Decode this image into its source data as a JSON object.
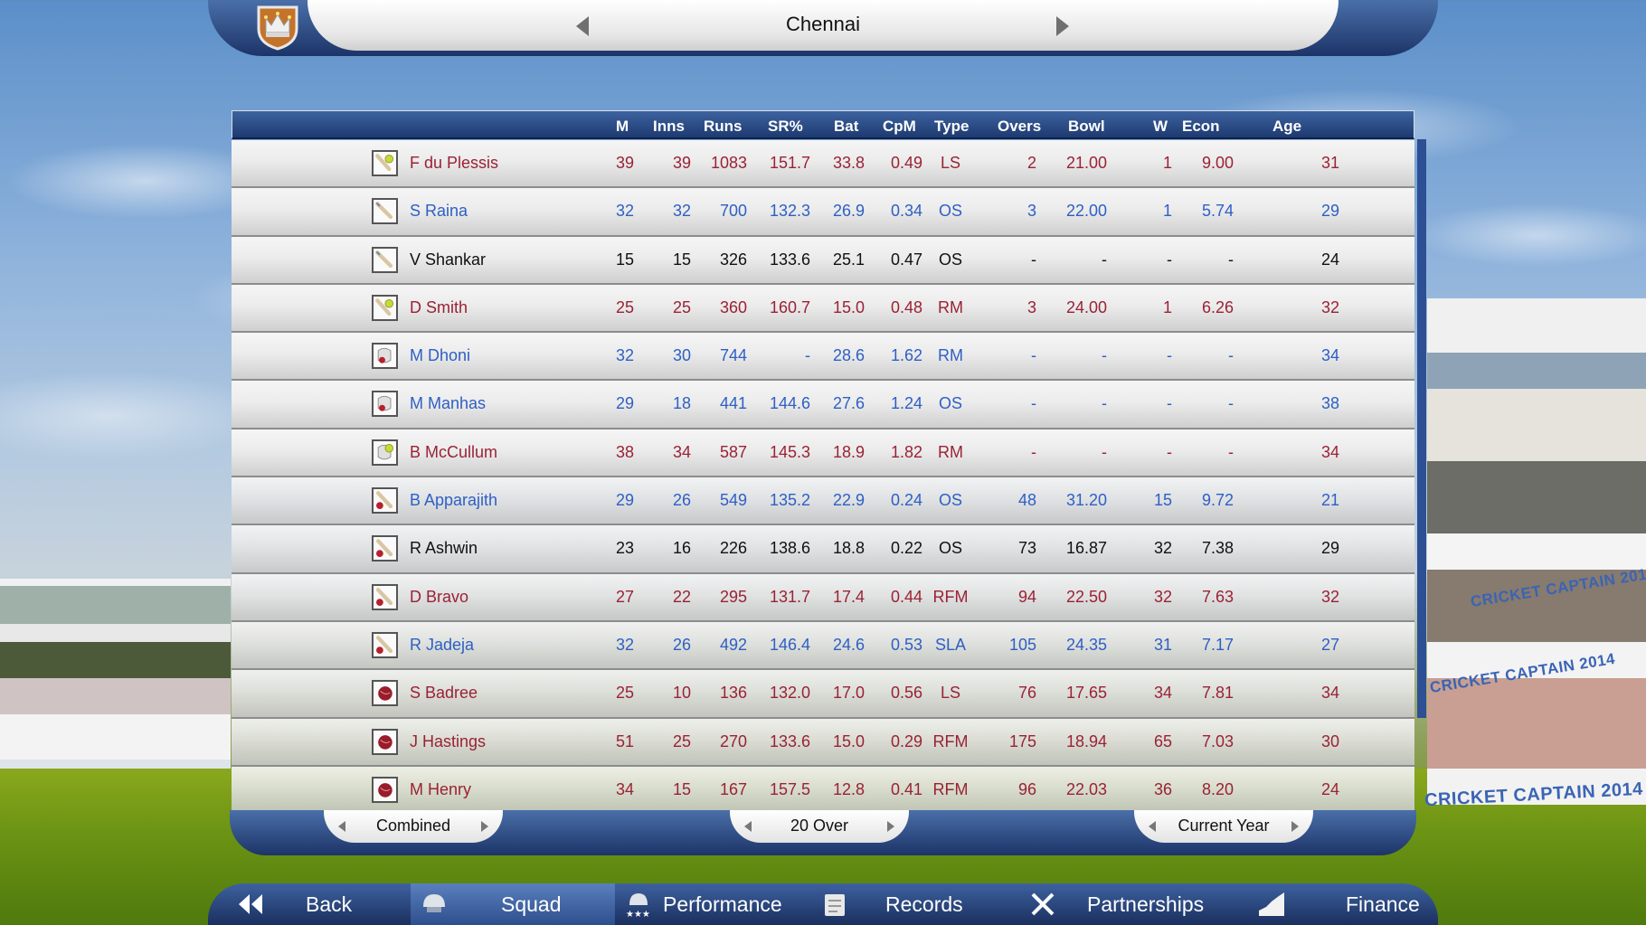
{
  "header": {
    "team": "Chennai",
    "crest_icon": "crown-shield-icon",
    "prev_icon": "arrow-left-icon",
    "next_icon": "arrow-right-icon"
  },
  "table": {
    "columns": [
      "M",
      "Inns",
      "Runs",
      "SR%",
      "Bat",
      "CpM",
      "Type",
      "Overs",
      "Bowl",
      "W",
      "Econ",
      "Age"
    ],
    "colors": {
      "red": "#9a2235",
      "blue": "#2e5fc4",
      "black": "#111111"
    },
    "rows": [
      {
        "role": "batsman-keeper-icon",
        "color": "red",
        "name": "F du Plessis",
        "M": "39",
        "Inns": "39",
        "Runs": "1083",
        "SR": "151.7",
        "Bat": "33.8",
        "CpM": "0.49",
        "Type": "LS",
        "Overs": "2",
        "Bowl": "21.00",
        "W": "1",
        "Econ": "9.00",
        "Age": "31"
      },
      {
        "role": "batsman-icon",
        "color": "blue",
        "name": "S Raina",
        "M": "32",
        "Inns": "32",
        "Runs": "700",
        "SR": "132.3",
        "Bat": "26.9",
        "CpM": "0.34",
        "Type": "OS",
        "Overs": "3",
        "Bowl": "22.00",
        "W": "1",
        "Econ": "5.74",
        "Age": "29"
      },
      {
        "role": "batsman-icon",
        "color": "black",
        "name": "V Shankar",
        "M": "15",
        "Inns": "15",
        "Runs": "326",
        "SR": "133.6",
        "Bat": "25.1",
        "CpM": "0.47",
        "Type": "OS",
        "Overs": "-",
        "Bowl": "-",
        "W": "-",
        "Econ": "-",
        "Age": "24"
      },
      {
        "role": "batsman-keeper-icon",
        "color": "red",
        "name": "D Smith",
        "M": "25",
        "Inns": "25",
        "Runs": "360",
        "SR": "160.7",
        "Bat": "15.0",
        "CpM": "0.48",
        "Type": "RM",
        "Overs": "3",
        "Bowl": "24.00",
        "W": "1",
        "Econ": "6.26",
        "Age": "32"
      },
      {
        "role": "wicketkeeper-icon",
        "color": "blue",
        "name": "M Dhoni",
        "M": "32",
        "Inns": "30",
        "Runs": "744",
        "SR": "-",
        "Bat": "28.6",
        "CpM": "1.62",
        "Type": "RM",
        "Overs": "-",
        "Bowl": "-",
        "W": "-",
        "Econ": "-",
        "Age": "34"
      },
      {
        "role": "wicketkeeper-icon",
        "color": "blue",
        "name": "M Manhas",
        "M": "29",
        "Inns": "18",
        "Runs": "441",
        "SR": "144.6",
        "Bat": "27.6",
        "CpM": "1.24",
        "Type": "OS",
        "Overs": "-",
        "Bowl": "-",
        "W": "-",
        "Econ": "-",
        "Age": "38"
      },
      {
        "role": "keeper-gloves-icon",
        "color": "red",
        "name": "B McCullum",
        "M": "38",
        "Inns": "34",
        "Runs": "587",
        "SR": "145.3",
        "Bat": "18.9",
        "CpM": "1.82",
        "Type": "RM",
        "Overs": "-",
        "Bowl": "-",
        "W": "-",
        "Econ": "-",
        "Age": "34"
      },
      {
        "role": "allrounder-icon",
        "color": "blue",
        "name": "B Apparajith",
        "M": "29",
        "Inns": "26",
        "Runs": "549",
        "SR": "135.2",
        "Bat": "22.9",
        "CpM": "0.24",
        "Type": "OS",
        "Overs": "48",
        "Bowl": "31.20",
        "W": "15",
        "Econ": "9.72",
        "Age": "21"
      },
      {
        "role": "allrounder-icon",
        "color": "black",
        "name": "R Ashwin",
        "M": "23",
        "Inns": "16",
        "Runs": "226",
        "SR": "138.6",
        "Bat": "18.8",
        "CpM": "0.22",
        "Type": "OS",
        "Overs": "73",
        "Bowl": "16.87",
        "W": "32",
        "Econ": "7.38",
        "Age": "29"
      },
      {
        "role": "allrounder-icon",
        "color": "red",
        "name": "D Bravo",
        "M": "27",
        "Inns": "22",
        "Runs": "295",
        "SR": "131.7",
        "Bat": "17.4",
        "CpM": "0.44",
        "Type": "RFM",
        "Overs": "94",
        "Bowl": "22.50",
        "W": "32",
        "Econ": "7.63",
        "Age": "32"
      },
      {
        "role": "allrounder-icon",
        "color": "blue",
        "name": "R Jadeja",
        "M": "32",
        "Inns": "26",
        "Runs": "492",
        "SR": "146.4",
        "Bat": "24.6",
        "CpM": "0.53",
        "Type": "SLA",
        "Overs": "105",
        "Bowl": "24.35",
        "W": "31",
        "Econ": "7.17",
        "Age": "27"
      },
      {
        "role": "bowler-icon",
        "color": "red",
        "name": "S Badree",
        "M": "25",
        "Inns": "10",
        "Runs": "136",
        "SR": "132.0",
        "Bat": "17.0",
        "CpM": "0.56",
        "Type": "LS",
        "Overs": "76",
        "Bowl": "17.65",
        "W": "34",
        "Econ": "7.81",
        "Age": "34"
      },
      {
        "role": "bowler-icon",
        "color": "red",
        "name": "J Hastings",
        "M": "51",
        "Inns": "25",
        "Runs": "270",
        "SR": "133.6",
        "Bat": "15.0",
        "CpM": "0.29",
        "Type": "RFM",
        "Overs": "175",
        "Bowl": "18.94",
        "W": "65",
        "Econ": "7.03",
        "Age": "30"
      },
      {
        "role": "bowler-icon",
        "color": "red",
        "name": "M Henry",
        "M": "34",
        "Inns": "15",
        "Runs": "167",
        "SR": "157.5",
        "Bat": "12.8",
        "CpM": "0.41",
        "Type": "RFM",
        "Overs": "96",
        "Bowl": "22.03",
        "W": "36",
        "Econ": "8.20",
        "Age": "24"
      }
    ]
  },
  "filters": {
    "competition": "Combined",
    "format": "20 Over",
    "period": "Current Year"
  },
  "nav": {
    "items": [
      {
        "label": "Back",
        "icon": "double-chevron-left-icon",
        "active": false
      },
      {
        "label": "Squad",
        "icon": "helmet-icon",
        "active": true
      },
      {
        "label": "Performance",
        "icon": "helmet-stars-icon",
        "active": false
      },
      {
        "label": "Records",
        "icon": "clipboard-icon",
        "active": false
      },
      {
        "label": "Partnerships",
        "icon": "crossed-bats-icon",
        "active": false
      },
      {
        "label": "Finance",
        "icon": "rising-graph-icon",
        "active": false
      }
    ]
  },
  "background": {
    "banner_text": "CRICKET CAPTAIN 2014"
  }
}
